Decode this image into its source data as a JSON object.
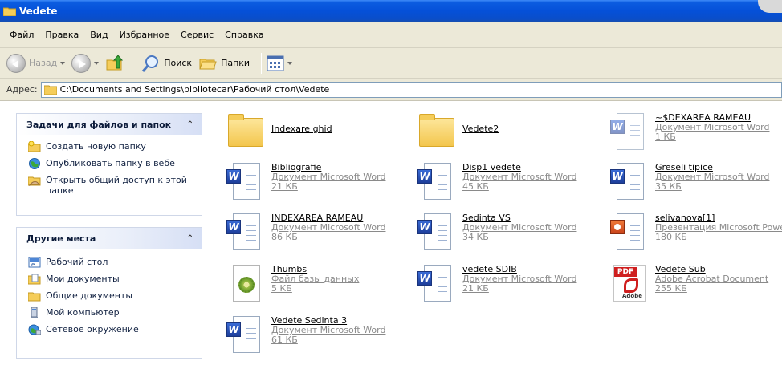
{
  "window": {
    "title": "Vedete"
  },
  "menu": [
    "Файл",
    "Правка",
    "Вид",
    "Избранное",
    "Сервис",
    "Справка"
  ],
  "toolbar": {
    "back": "Назад",
    "search": "Поиск",
    "folders": "Папки"
  },
  "address": {
    "label": "Адрес:",
    "path": "C:\\Documents and Settings\\bibliotecar\\Рабочий стол\\Vedete"
  },
  "tasks_panel": {
    "title": "Задачи для файлов и папок",
    "items": [
      {
        "label": "Создать новую папку",
        "icon": "new-folder-icon"
      },
      {
        "label": "Опубликовать папку в вебе",
        "icon": "globe-icon"
      },
      {
        "label": "Открыть общий доступ к этой папке",
        "icon": "share-folder-icon"
      }
    ]
  },
  "places_panel": {
    "title": "Другие места",
    "items": [
      {
        "label": "Рабочий стол",
        "icon": "desktop-icon"
      },
      {
        "label": "Мои документы",
        "icon": "my-documents-icon"
      },
      {
        "label": "Общие документы",
        "icon": "shared-documents-icon"
      },
      {
        "label": "Мой компьютер",
        "icon": "my-computer-icon"
      },
      {
        "label": "Сетевое окружение",
        "icon": "network-icon"
      }
    ]
  },
  "files": [
    {
      "name": "Indexare ghid",
      "type": "",
      "size": "",
      "icon": "folder-icon"
    },
    {
      "name": "Vedete2",
      "type": "",
      "size": "",
      "icon": "folder-icon"
    },
    {
      "name": "~$DEXAREA RAMEAU",
      "type": "Документ Microsoft Word",
      "size": "1 КБ",
      "icon": "word-doc-icon"
    },
    {
      "name": "Bibliografie",
      "type": "Документ Microsoft Word",
      "size": "21 КБ",
      "icon": "word-doc-icon"
    },
    {
      "name": "Disp1 vedete",
      "type": "Документ Microsoft Word",
      "size": "45 КБ",
      "icon": "word-doc-icon"
    },
    {
      "name": "Greseli tipice",
      "type": "Документ Microsoft Word",
      "size": "35 КБ",
      "icon": "word-doc-icon"
    },
    {
      "name": "INDEXAREA RAMEAU",
      "type": "Документ Microsoft Word",
      "size": "86 КБ",
      "icon": "word-doc-icon"
    },
    {
      "name": "Sedinta VS",
      "type": "Документ Microsoft Word",
      "size": "34 КБ",
      "icon": "word-doc-icon"
    },
    {
      "name": "selivanova[1]",
      "type": "Презентация Microsoft Power",
      "size": "180 КБ",
      "icon": "powerpoint-icon"
    },
    {
      "name": "Thumbs",
      "type": "Файл базы данных",
      "size": "5 КБ",
      "icon": "database-file-icon"
    },
    {
      "name": "vedete SDIB",
      "type": "Документ Microsoft Word",
      "size": "21 КБ",
      "icon": "word-doc-icon"
    },
    {
      "name": "Vedete Sub",
      "type": "Adobe Acrobat Document",
      "size": "255 КБ",
      "icon": "pdf-icon"
    },
    {
      "name": "Vedete Sedinta 3",
      "type": "Документ Microsoft Word",
      "size": "61 КБ",
      "icon": "word-doc-icon"
    }
  ]
}
